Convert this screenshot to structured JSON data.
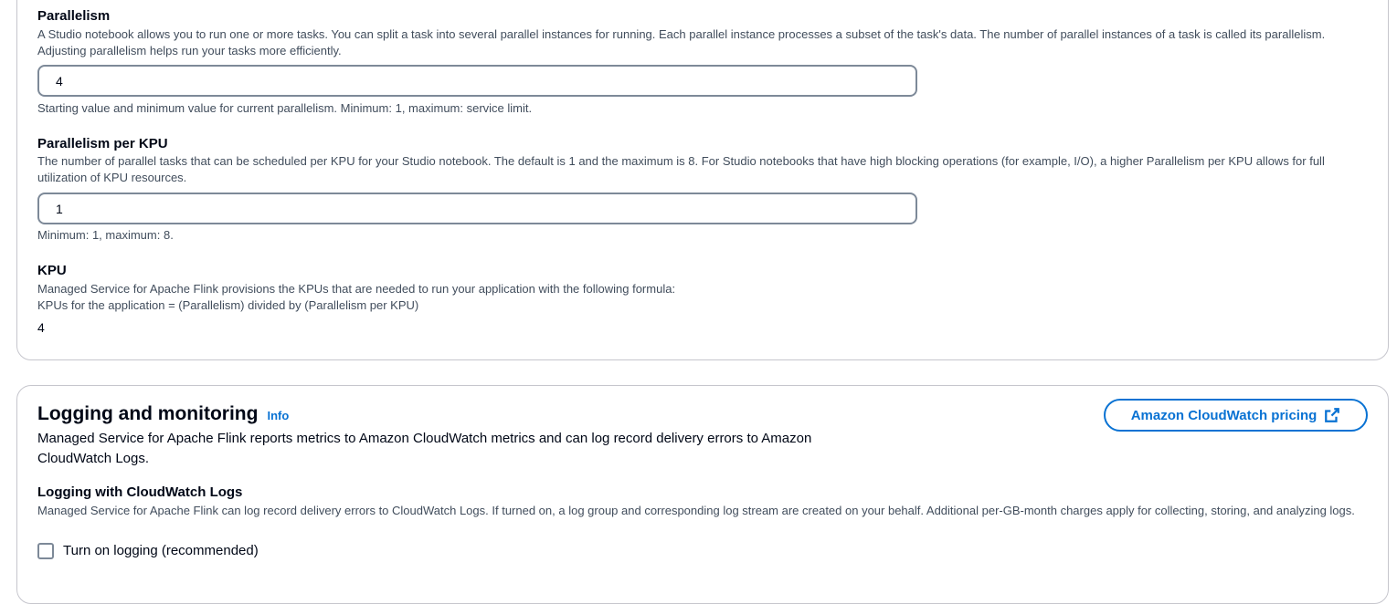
{
  "parallelism": {
    "label": "Parallelism",
    "description": "A Studio notebook allows you to run one or more tasks. You can split a task into several parallel instances for running. Each parallel instance processes a subset of the task's data. The number of parallel instances of a task is called its parallelism. Adjusting parallelism helps run your tasks more efficiently.",
    "value": "4",
    "hint": "Starting value and minimum value for current parallelism. Minimum: 1, maximum: service limit."
  },
  "parallelism_per_kpu": {
    "label": "Parallelism per KPU",
    "description": "The number of parallel tasks that can be scheduled per KPU for your Studio notebook. The default is 1 and the maximum is 8. For Studio notebooks that have high blocking operations (for example, I/O), a higher Parallelism per KPU allows for full utilization of KPU resources.",
    "value": "1",
    "hint": "Minimum: 1, maximum: 8."
  },
  "kpu": {
    "label": "KPU",
    "description_line1": "Managed Service for Apache Flink provisions the KPUs that are needed to run your application with the following formula:",
    "description_line2": "KPUs for the application = (Parallelism) divided by (Parallelism per KPU)",
    "value": "4"
  },
  "logging_monitoring": {
    "title": "Logging and monitoring",
    "info_link": "Info",
    "description": "Managed Service for Apache Flink reports metrics to Amazon CloudWatch metrics and can log record delivery errors to Amazon CloudWatch Logs.",
    "pricing_button": "Amazon CloudWatch pricing",
    "pricing_icon": "external-link-icon",
    "cloudwatch_logs": {
      "label": "Logging with CloudWatch Logs",
      "description": "Managed Service for Apache Flink can log record delivery errors to CloudWatch Logs. If turned on, a log group and corresponding log stream are created on your behalf. Additional per-GB-month charges apply for collecting, storing, and analyzing logs.",
      "checkbox_label": "Turn on logging (recommended)",
      "checked": false
    }
  },
  "colors": {
    "link_blue": "#0972d3",
    "border_gray": "#c6c6cd",
    "input_border": "#7d8998",
    "text_dark": "#000716",
    "text_secondary": "#414d5c"
  }
}
